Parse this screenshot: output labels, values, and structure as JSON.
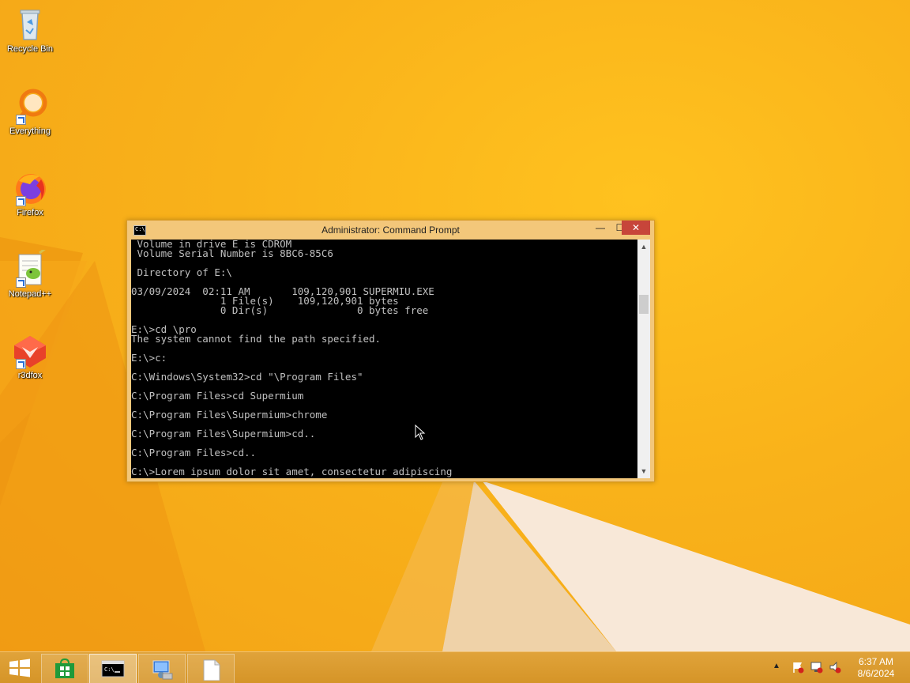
{
  "desktop": {
    "icons": [
      {
        "label": "Recycle Bin",
        "icon": "recycle-bin-icon"
      },
      {
        "label": "Everything",
        "icon": "everything-search-icon"
      },
      {
        "label": "Firefox",
        "icon": "firefox-icon"
      },
      {
        "label": "Notepad++",
        "icon": "notepad-plus-plus-icon"
      },
      {
        "label": "r3dfox",
        "icon": "r3dfox-icon"
      }
    ]
  },
  "cmd_window": {
    "title": "Administrator: Command Prompt",
    "icon_text": "C:\\",
    "controls": {
      "minimize": "—",
      "maximize": "☐",
      "close": "✕"
    },
    "lines": [
      " Volume in drive E is CDROM",
      " Volume Serial Number is 8BC6-85C6",
      "",
      " Directory of E:\\",
      "",
      "03/09/2024  02:11 AM       109,120,901 SUPERMIU.EXE",
      "               1 File(s)    109,120,901 bytes",
      "               0 Dir(s)               0 bytes free",
      "",
      "E:\\>cd \\pro",
      "The system cannot find the path specified.",
      "",
      "E:\\>c:",
      "",
      "C:\\Windows\\System32>cd \"\\Program Files\"",
      "",
      "C:\\Program Files>cd Supermium",
      "",
      "C:\\Program Files\\Supermium>chrome",
      "",
      "C:\\Program Files\\Supermium>cd..",
      "",
      "C:\\Program Files>cd..",
      "",
      "C:\\>Lorem ipsum dolor sit amet, consectetur adipiscing"
    ],
    "text_color": "#c0c0c0",
    "background_color": "#000000"
  },
  "taskbar": {
    "start_icon": "windows-start-icon",
    "items": [
      {
        "name": "store",
        "icon": "store-icon",
        "active": false
      },
      {
        "name": "command-prompt",
        "icon": "command-prompt-icon",
        "active": true
      },
      {
        "name": "network",
        "icon": "network-computer-icon",
        "active": false
      },
      {
        "name": "file",
        "icon": "blank-file-icon",
        "active": false
      }
    ],
    "tray": {
      "arrow": "▲",
      "icons": [
        "action-center-flag-icon",
        "network-disconnected-icon",
        "volume-muted-icon"
      ]
    },
    "clock": {
      "time": "6:37 AM",
      "date": "8/6/2024"
    }
  },
  "colors": {
    "wallpaper": "#f9b21a",
    "taskbar": "#d8982b",
    "window_frame": "#f3c77a",
    "close_button": "#c7453a"
  }
}
